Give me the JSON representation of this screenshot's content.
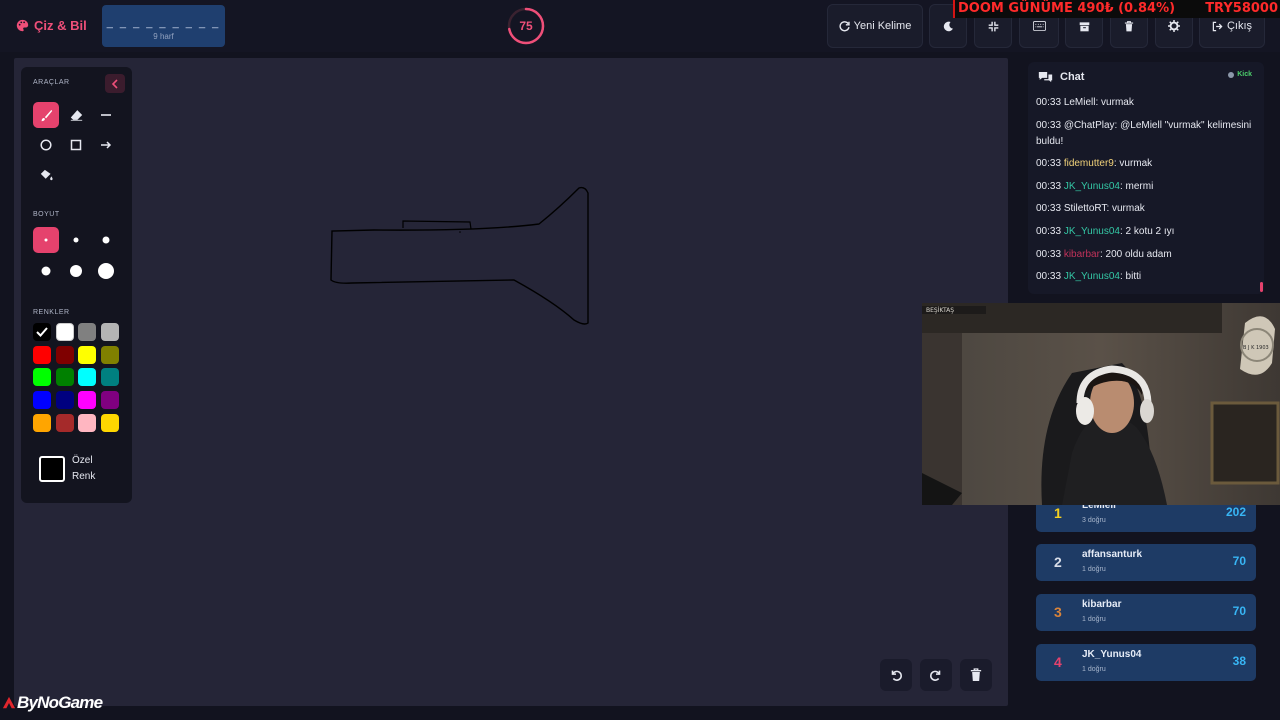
{
  "app": {
    "brand": "Çiz & Bil",
    "word_pattern": "_ _ _ _ _ _ _ _ _",
    "word_hint": "9 harf",
    "timer": "75",
    "timer_fraction": 0.72
  },
  "toolbar": {
    "new_word": "Yeni Kelime",
    "logout": "Çıkış",
    "icons": [
      "moon-icon",
      "compress-icon",
      "keyboard-icon",
      "archive-icon",
      "trash-icon",
      "gear-icon"
    ]
  },
  "ticker": {
    "text": "DOOM GÜNÜME  490₺ (0.84%)",
    "right": "TRY58000"
  },
  "tools": {
    "title_tools": "ARAÇLAR",
    "title_size": "BOYUT",
    "title_colors": "RENKLER",
    "custom_color_label": "Özel Renk",
    "tool_icons": [
      "brush-icon",
      "eraser-icon",
      "line-icon",
      "circle-icon",
      "square-icon",
      "arrow-icon",
      "fill-bucket-icon"
    ],
    "colors": [
      "#000000",
      "#ffffff",
      "#808080",
      "#b4b4b4",
      "#ff0000",
      "#7f0000",
      "#ffff00",
      "#808000",
      "#00ff00",
      "#008000",
      "#00ffff",
      "#008080",
      "#0000ff",
      "#000080",
      "#ff00ff",
      "#800080",
      "#ffa500",
      "#a52a2a",
      "#ffb6c1",
      "#ffd700"
    ],
    "accent": "#e5426d"
  },
  "chat": {
    "title": "Chat",
    "platform": "Kick",
    "messages": [
      {
        "time": "00:33",
        "user": "LeMiell",
        "text": ": vurmak",
        "color": "#e6e8f0"
      },
      {
        "time": "00:33",
        "user": "@ChatPlay",
        "text": ": @LeMiell \"vurmak\" kelimesini buldu!",
        "color": "#e6e8f0"
      },
      {
        "time": "00:33",
        "user": "fidemutter9",
        "text": ": vurmak",
        "color": "#f2d27a"
      },
      {
        "time": "00:33",
        "user": "JK_Yunus04",
        "text": ": mermi",
        "color": "#34c7a5"
      },
      {
        "time": "00:33",
        "user": "StilettoRT",
        "text": ": vurmak",
        "color": "#e6e8f0"
      },
      {
        "time": "00:33",
        "user": "JK_Yunus04",
        "text": ": 2 kotu 2 ıyı",
        "color": "#34c7a5"
      },
      {
        "time": "00:33",
        "user": "kibarbar",
        "text": ": 200 oldu adam",
        "color": "#c2325a"
      },
      {
        "time": "00:33",
        "user": "JK_Yunus04",
        "text": ": bitti",
        "color": "#34c7a5"
      }
    ]
  },
  "webcam": {
    "banner": "BEŞİKTAŞ",
    "crest": "B J K 1903"
  },
  "leaderboard": [
    {
      "rank": "1",
      "name": "LeMiell",
      "sub": "3 doğru",
      "score": "202",
      "rank_color": "#f5d020"
    },
    {
      "rank": "2",
      "name": "affansanturk",
      "sub": "1 doğru",
      "score": "70",
      "rank_color": "#d8dde8"
    },
    {
      "rank": "3",
      "name": "kibarbar",
      "sub": "1 doğru",
      "score": "70",
      "rank_color": "#d9843b"
    },
    {
      "rank": "4",
      "name": "JK_Yunus04",
      "sub": "1 doğru",
      "score": "38",
      "rank_color": "#e5426d"
    }
  ],
  "watermark": "ByNoGame"
}
